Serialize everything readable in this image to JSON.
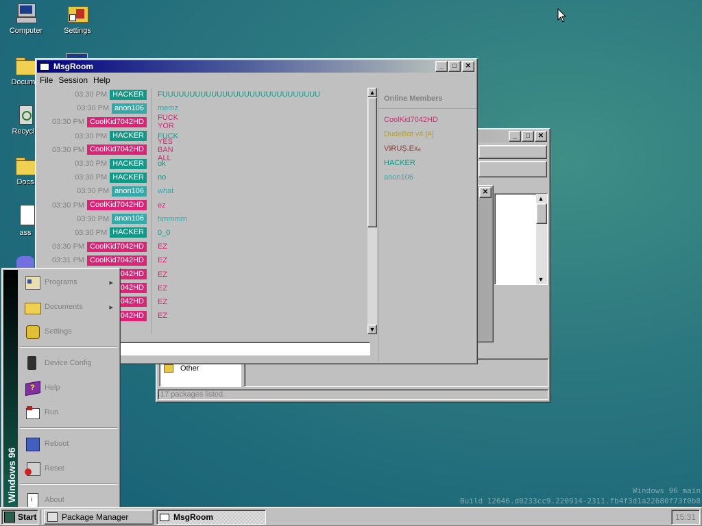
{
  "desktop": {
    "icons": [
      {
        "label": "Computer",
        "icon": "computer-icon"
      },
      {
        "label": "Settings",
        "icon": "settings-icon"
      },
      {
        "label": "Docume",
        "icon": "folder-icon"
      },
      {
        "label": "Recycle",
        "icon": "recycle-bin-icon"
      },
      {
        "label": "Docs",
        "icon": "folder-icon"
      },
      {
        "label": "ass",
        "icon": "document-icon"
      }
    ],
    "watermark": {
      "line1": "Windows 96 main",
      "line2": "Build 12646.d0233cc9.220914-2311.fb4f3d1a22680f73f0b8"
    }
  },
  "msgroom": {
    "title": "MsgRoom",
    "menu": [
      "File",
      "Session",
      "Help"
    ],
    "messages": [
      {
        "time": "03:30 PM",
        "user": "HACKER",
        "text": "FUUUUUUUUUUUUUUUUUUUUUUUUUUUUU",
        "color": "#119988"
      },
      {
        "time": "03:30 PM",
        "user": "anon106",
        "text": "memz",
        "color": "#33aaaa"
      },
      {
        "time": "03:30 PM",
        "user": "CoolKid7042HD",
        "text": "FUCK YOR",
        "color": "#dd2277"
      },
      {
        "time": "03:30 PM",
        "user": "HACKER",
        "text": "FUCK",
        "color": "#119988"
      },
      {
        "time": "03:30 PM",
        "user": "CoolKid7042HD",
        "text": "YES BAN ALL",
        "color": "#dd2277"
      },
      {
        "time": "03:30 PM",
        "user": "HACKER",
        "text": "ok",
        "color": "#119988"
      },
      {
        "time": "03:30 PM",
        "user": "HACKER",
        "text": "no",
        "color": "#119988"
      },
      {
        "time": "03:30 PM",
        "user": "anon106",
        "text": "what",
        "color": "#33aaaa"
      },
      {
        "time": "03:30 PM",
        "user": "CoolKid7042HD",
        "text": "ez",
        "color": "#dd2277"
      },
      {
        "time": "03:30 PM",
        "user": "anon106",
        "text": "hmmmm",
        "color": "#33aaaa"
      },
      {
        "time": "03:30 PM",
        "user": "HACKER",
        "text": "0_0",
        "color": "#119988"
      },
      {
        "time": "03:30 PM",
        "user": "CoolKid7042HD",
        "text": "EZ",
        "color": "#dd2277"
      },
      {
        "time": "03:31 PM",
        "user": "CoolKid7042HD",
        "text": "EZ",
        "color": "#dd2277"
      },
      {
        "time": "",
        "user": "042HD",
        "text": "EZ",
        "color": "#dd2277"
      },
      {
        "time": "",
        "user": "042HD",
        "text": "EZ",
        "color": "#dd2277"
      },
      {
        "time": "",
        "user": "042HD",
        "text": "EZ",
        "color": "#dd2277"
      },
      {
        "time": "",
        "user": "042HD",
        "text": "EZ",
        "color": "#dd2277"
      }
    ],
    "members_title": "Online Members",
    "members": [
      {
        "name": "CoolKid7042HD",
        "color": "#dd2277"
      },
      {
        "name": "DudeBot v4 [#]",
        "color": "#b8a020"
      },
      {
        "name": "VI̷RUŞ.Exₔ",
        "color": "#8a4040"
      },
      {
        "name": "HACKER",
        "color": "#119988"
      },
      {
        "name": "anon106",
        "color": "#33aaaa"
      }
    ],
    "input_value": ""
  },
  "package_manager": {
    "title": "Package Manager",
    "category_other": "Other",
    "status": "17 packages listed."
  },
  "start_menu": {
    "brand": "Windows 96",
    "items": [
      {
        "label": "Programs",
        "icon": "programs-icon",
        "submenu": true
      },
      {
        "label": "Documents",
        "icon": "documents-folder-icon",
        "submenu": true
      },
      {
        "label": "Settings",
        "icon": "settings-gear-icon",
        "submenu": false
      },
      {
        "label": "Device Config",
        "icon": "device-icon",
        "submenu": false
      },
      {
        "label": "Help",
        "icon": "help-book-icon",
        "submenu": false
      },
      {
        "label": "Run",
        "icon": "run-icon",
        "submenu": false
      },
      {
        "label": "Reboot",
        "icon": "reboot-icon",
        "submenu": false
      },
      {
        "label": "Reset",
        "icon": "reset-icon",
        "submenu": false
      },
      {
        "label": "About",
        "icon": "about-icon",
        "submenu": false
      }
    ]
  },
  "taskbar": {
    "start_label": "Start",
    "tasks": [
      {
        "label": "Package Manager",
        "active": false
      },
      {
        "label": "MsgRoom",
        "active": true
      }
    ],
    "clock": "15:31"
  }
}
